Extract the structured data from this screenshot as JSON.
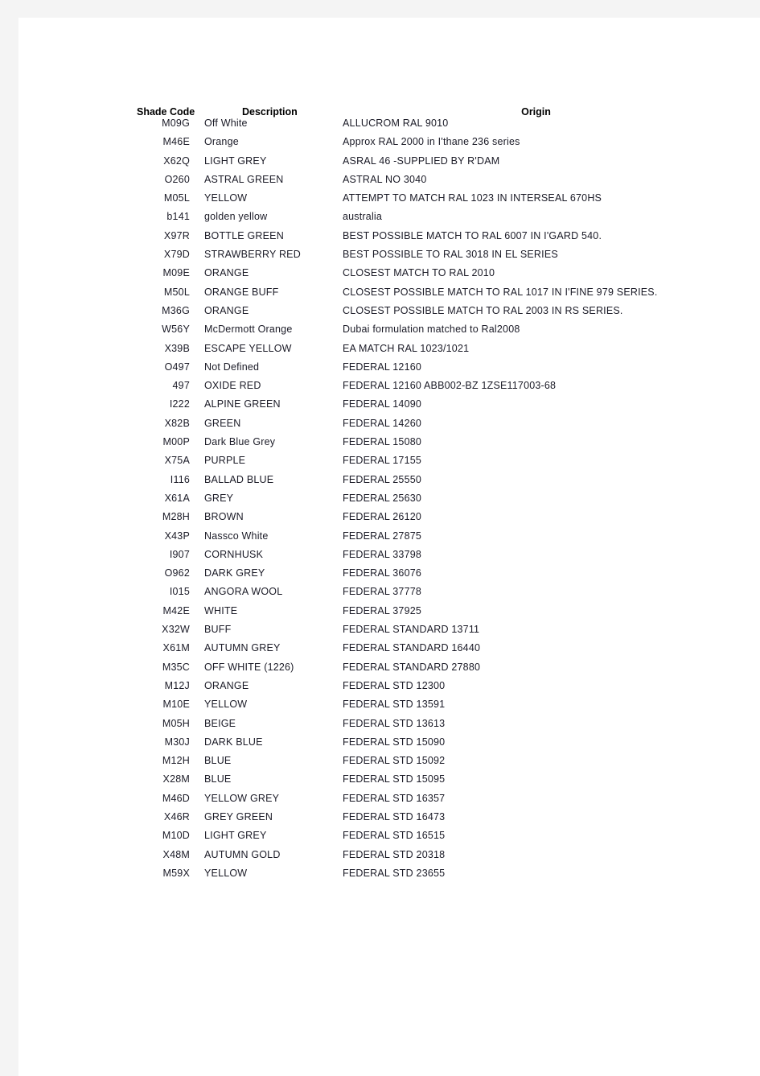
{
  "document": {
    "page_background": "#ffffff",
    "canvas_background": "#f4f4f4",
    "text_color": "#1b1b27"
  },
  "table": {
    "headers": {
      "shade_code": "Shade Code",
      "description": "Description",
      "origin": "Origin"
    },
    "rows": [
      {
        "code": "M09G",
        "description": "Off White",
        "origin": "ALLUCROM RAL 9010"
      },
      {
        "code": "M46E",
        "description": "Orange",
        "origin": "Approx RAL 2000 in I'thane 236 series"
      },
      {
        "code": "X62Q",
        "description": "LIGHT GREY",
        "origin": "ASRAL 46 -SUPPLIED BY R'DAM"
      },
      {
        "code": "O260",
        "description": "ASTRAL GREEN",
        "origin": "ASTRAL NO 3040"
      },
      {
        "code": "M05L",
        "description": "YELLOW",
        "origin": "ATTEMPT TO MATCH RAL 1023 IN INTERSEAL 670HS"
      },
      {
        "code": "b141",
        "description": "golden yellow",
        "origin": "australia"
      },
      {
        "code": "X97R",
        "description": "BOTTLE GREEN",
        "origin": "BEST POSSIBLE MATCH TO RAL 6007 IN I'GARD 540."
      },
      {
        "code": "X79D",
        "description": "STRAWBERRY RED",
        "origin": "BEST POSSIBLE TO RAL 3018 IN EL SERIES"
      },
      {
        "code": "M09E",
        "description": "ORANGE",
        "origin": "CLOSEST MATCH TO RAL 2010"
      },
      {
        "code": "M50L",
        "description": "ORANGE BUFF",
        "origin": "CLOSEST POSSIBLE MATCH TO RAL 1017 IN I'FINE 979 SERIES."
      },
      {
        "code": "M36G",
        "description": "ORANGE",
        "origin": "CLOSEST POSSIBLE MATCH TO RAL 2003 IN RS SERIES."
      },
      {
        "code": "W56Y",
        "description": "McDermott Orange",
        "origin": "Dubai formulation matched to Ral2008"
      },
      {
        "code": "X39B",
        "description": "ESCAPE YELLOW",
        "origin": "EA MATCH RAL 1023/1021"
      },
      {
        "code": "O497",
        "description": "Not Defined",
        "origin": "FEDERAL 12160"
      },
      {
        "code": "497",
        "description": "OXIDE RED",
        "origin": "FEDERAL 12160 ABB002-BZ 1ZSE117003-68"
      },
      {
        "code": "I222",
        "description": "ALPINE GREEN",
        "origin": "FEDERAL 14090"
      },
      {
        "code": "X82B",
        "description": "GREEN",
        "origin": "FEDERAL 14260"
      },
      {
        "code": "M00P",
        "description": "Dark Blue Grey",
        "origin": "FEDERAL 15080"
      },
      {
        "code": "X75A",
        "description": "PURPLE",
        "origin": "FEDERAL 17155"
      },
      {
        "code": "I116",
        "description": "BALLAD BLUE",
        "origin": "FEDERAL 25550"
      },
      {
        "code": "X61A",
        "description": "GREY",
        "origin": "FEDERAL 25630"
      },
      {
        "code": "M28H",
        "description": "BROWN",
        "origin": "FEDERAL 26120"
      },
      {
        "code": "X43P",
        "description": "Nassco White",
        "origin": "FEDERAL 27875"
      },
      {
        "code": "I907",
        "description": "CORNHUSK",
        "origin": "FEDERAL 33798"
      },
      {
        "code": "O962",
        "description": "DARK GREY",
        "origin": "FEDERAL 36076"
      },
      {
        "code": "I015",
        "description": "ANGORA WOOL",
        "origin": "FEDERAL 37778"
      },
      {
        "code": "M42E",
        "description": "WHITE",
        "origin": "FEDERAL 37925"
      },
      {
        "code": "X32W",
        "description": "BUFF",
        "origin": "FEDERAL STANDARD 13711"
      },
      {
        "code": "X61M",
        "description": "AUTUMN GREY",
        "origin": "FEDERAL STANDARD 16440"
      },
      {
        "code": "M35C",
        "description": "OFF WHITE (1226)",
        "origin": "FEDERAL STANDARD 27880"
      },
      {
        "code": "M12J",
        "description": "ORANGE",
        "origin": "FEDERAL STD 12300"
      },
      {
        "code": "M10E",
        "description": "YELLOW",
        "origin": "FEDERAL STD 13591"
      },
      {
        "code": "M05H",
        "description": "BEIGE",
        "origin": "FEDERAL STD 13613"
      },
      {
        "code": "M30J",
        "description": "DARK BLUE",
        "origin": "FEDERAL STD 15090"
      },
      {
        "code": "M12H",
        "description": "BLUE",
        "origin": "FEDERAL STD 15092"
      },
      {
        "code": "X28M",
        "description": "BLUE",
        "origin": "FEDERAL STD 15095"
      },
      {
        "code": "M46D",
        "description": "YELLOW GREY",
        "origin": "FEDERAL STD 16357"
      },
      {
        "code": "X46R",
        "description": "GREY GREEN",
        "origin": "FEDERAL STD 16473"
      },
      {
        "code": "M10D",
        "description": "LIGHT GREY",
        "origin": "FEDERAL STD 16515"
      },
      {
        "code": "X48M",
        "description": "AUTUMN GOLD",
        "origin": "FEDERAL STD 20318"
      },
      {
        "code": "M59X",
        "description": "YELLOW",
        "origin": "FEDERAL STD 23655"
      }
    ]
  }
}
